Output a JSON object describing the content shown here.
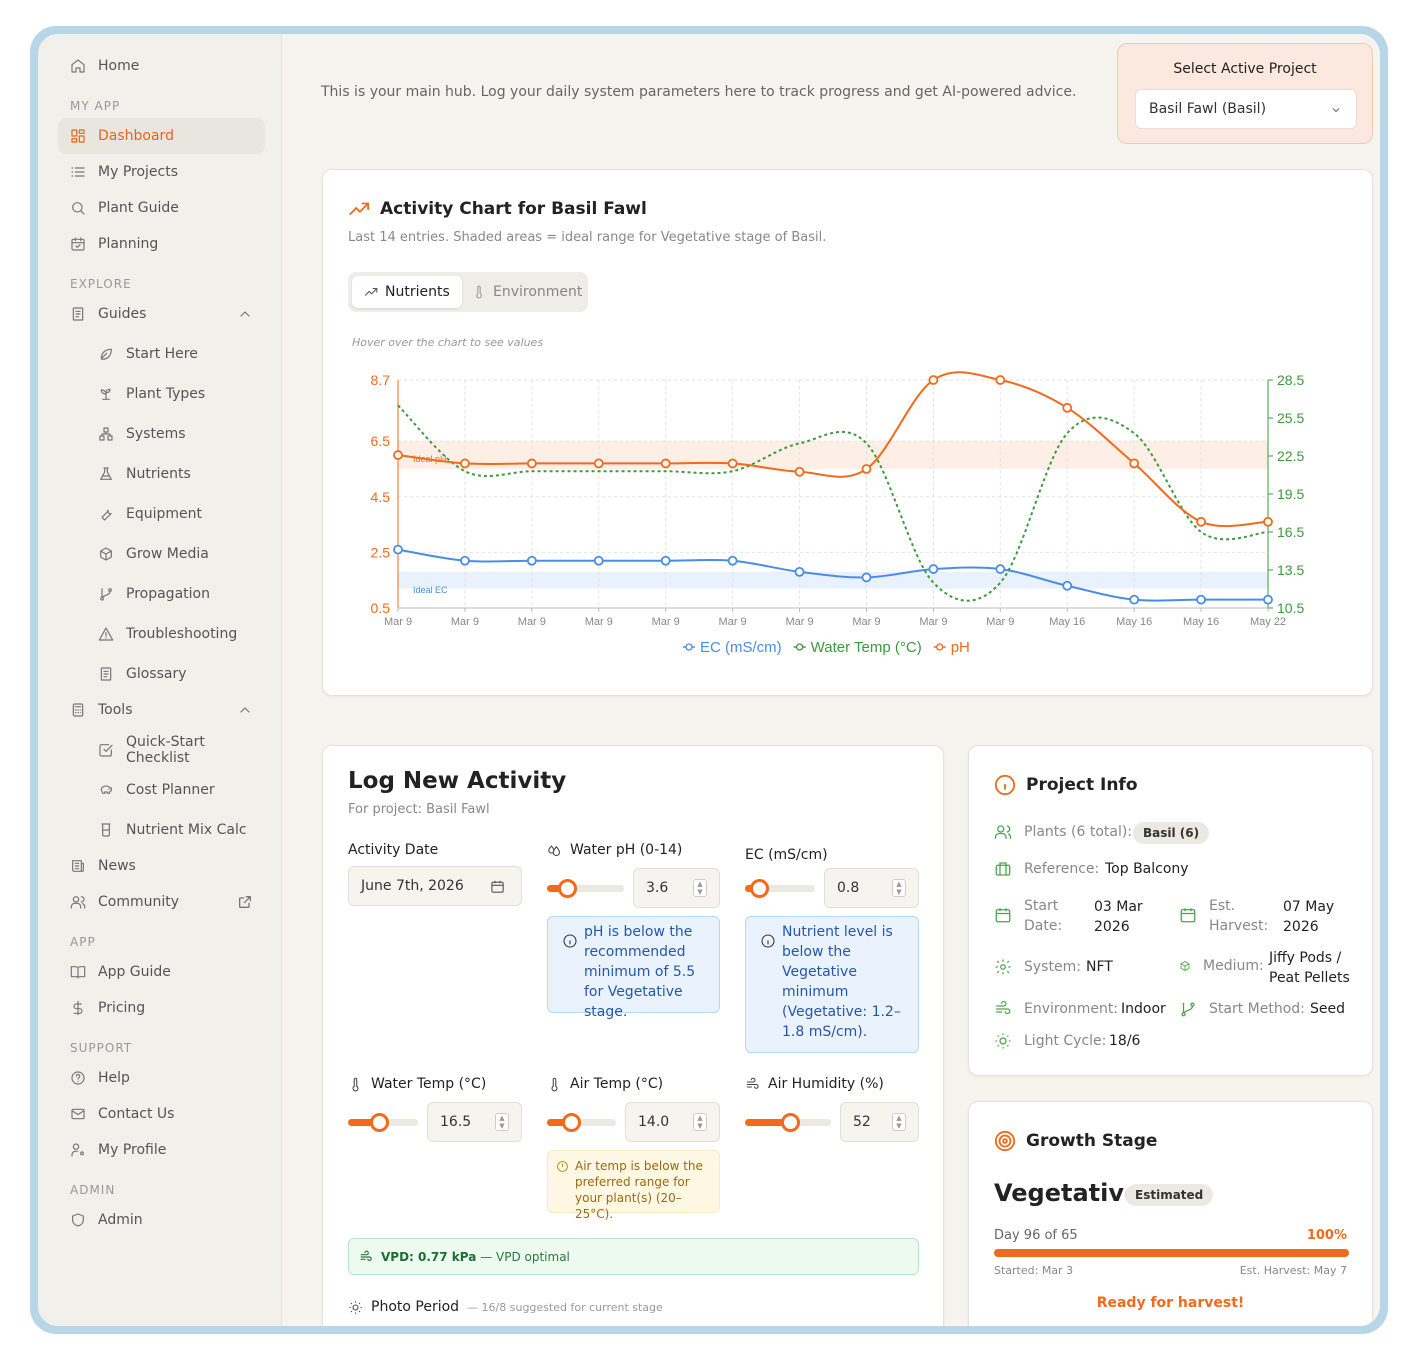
{
  "sidebar": {
    "home": "Home",
    "sections": {
      "my_app": "MY APP",
      "explore": "EXPLORE",
      "app": "APP",
      "support": "SUPPORT",
      "admin": "ADMIN"
    },
    "dashboard": "Dashboard",
    "my_projects": "My Projects",
    "plant_guide": "Plant Guide",
    "planning": "Planning",
    "guides": "Guides",
    "guide_items": [
      "Start Here",
      "Plant Types",
      "Systems",
      "Nutrients",
      "Equipment",
      "Grow Media",
      "Propagation",
      "Troubleshooting",
      "Glossary"
    ],
    "tools": "Tools",
    "tool_items": [
      "Quick-Start Checklist",
      "Cost Planner",
      "Nutrient Mix Calc"
    ],
    "news": "News",
    "community": "Community",
    "app_guide": "App Guide",
    "pricing": "Pricing",
    "help": "Help",
    "contact": "Contact Us",
    "profile": "My Profile",
    "admin": "Admin"
  },
  "intro": "This is your main hub. Log your daily system parameters here to track progress and get AI-powered advice.",
  "project_select": {
    "title": "Select Active Project",
    "value": "Basil Fawl (Basil)"
  },
  "chart_card": {
    "title": "Activity Chart for Basil Fawl",
    "subtitle": "Last 14 entries. Shaded areas = ideal range for Vegetative stage of Basil.",
    "tab_nutrients": "Nutrients",
    "tab_environment": "Environment",
    "hint": "Hover over the chart to see values"
  },
  "chart_data": {
    "type": "line",
    "x": [
      "Mar 9",
      "Mar 9",
      "Mar 9",
      "Mar 9",
      "Mar 9",
      "Mar 9",
      "Mar 9",
      "Mar 9",
      "Mar 9",
      "Mar 9",
      "May 16",
      "May 16",
      "May 16",
      "May 22"
    ],
    "left_axis": {
      "ticks": [
        "0.5",
        "2.5",
        "4.5",
        "6.5",
        "8.7"
      ],
      "range": [
        0.5,
        8.7
      ],
      "color": "#f26a1b"
    },
    "right_axis": {
      "ticks": [
        "10.5",
        "13.5",
        "16.5",
        "19.5",
        "22.5",
        "25.5",
        "28.5"
      ],
      "range": [
        10.5,
        28.5
      ],
      "color": "#3b9a3b"
    },
    "series": [
      {
        "name": "EC (mS/cm)",
        "axis": "left",
        "color": "#4a8de8",
        "values": [
          2.6,
          2.2,
          2.2,
          2.2,
          2.2,
          2.2,
          1.8,
          1.6,
          1.9,
          1.9,
          1.3,
          0.8,
          0.8,
          0.8
        ]
      },
      {
        "name": "Water Temp (°C)",
        "axis": "right",
        "color": "#3b9a3b",
        "dashed": true,
        "values": [
          26.5,
          21.3,
          21.3,
          21.3,
          21.3,
          21.3,
          23.5,
          23.5,
          12.5,
          12.5,
          24.3,
          24.3,
          16.5,
          16.5
        ]
      },
      {
        "name": "pH",
        "axis": "left",
        "color": "#f26a1b",
        "values": [
          6.0,
          5.7,
          5.7,
          5.7,
          5.7,
          5.7,
          5.4,
          5.5,
          8.7,
          8.7,
          7.7,
          5.7,
          3.6,
          3.6
        ]
      }
    ],
    "bands": [
      {
        "label": "Ideal pH",
        "axis": "left",
        "range": [
          5.5,
          6.5
        ],
        "color": "#fdeee6"
      },
      {
        "label": "Ideal EC",
        "axis": "left",
        "range": [
          1.2,
          1.8
        ],
        "color": "#e9f1fc"
      }
    ],
    "grid": true,
    "legend": "bottom"
  },
  "log": {
    "title": "Log New Activity",
    "subtitle": "For project: Basil Fawl",
    "date_label": "Activity Date",
    "date_value": "June 7th, 2026",
    "ph_label": "Water pH (0-14)",
    "ph_value": "3.6",
    "ph_level": 0.26,
    "ph_alert": "pH is below the recommended minimum of 5.5 for Vegetative stage.",
    "ec_label": "EC (mS/cm)",
    "ec_value": "0.8",
    "ec_level": 0.2,
    "ec_alert": "Nutrient level is below the Vegetative minimum (Vegetative: 1.2–1.8 mS/cm).",
    "water_temp_label": "Water Temp (°C)",
    "water_temp_value": "16.5",
    "water_temp_level": 0.44,
    "air_temp_label": "Air Temp (°C)",
    "air_temp_value": "14.0",
    "air_temp_level": 0.35,
    "air_temp_warn": "Air temp is below the preferred range for your plant(s) (20–25°C).",
    "humidity_label": "Air Humidity (%)",
    "humidity_value": "52",
    "humidity_level": 0.52,
    "vpd_value": "VPD: 0.77 kPa",
    "vpd_note": "— VPD optimal",
    "photo_label": "Photo Period",
    "photo_note": "— 16/8 suggested for current stage"
  },
  "project_info": {
    "title": "Project Info",
    "plants_label": "Plants (6 total):",
    "plants_badge": "Basil (6)",
    "reference_label": "Reference:",
    "reference_value": "Top Balcony",
    "start_label": "Start Date:",
    "start_value": "03 Mar 2026",
    "harvest_label": "Est. Harvest:",
    "harvest_value": "07 May 2026",
    "system_label": "System:",
    "system_value": "NFT",
    "medium_label": "Medium:",
    "medium_value": "Jiffy Pods / Peat Pellets",
    "environment_label": "Environment:",
    "environment_value": "Indoor",
    "method_label": "Start Method:",
    "method_value": "Seed",
    "light_label": "Light Cycle:",
    "light_value": "18/6"
  },
  "growth": {
    "title": "Growth Stage",
    "stage": "Vegetative",
    "badge": "Estimated",
    "day_text": "Day 96 of 65",
    "percent": "100%",
    "progress": 1.0,
    "started": "Started: Mar 3",
    "est_harvest": "Est. Harvest: May 7",
    "ready": "Ready for harvest!"
  },
  "colors": {
    "accent": "#f26a1b",
    "green": "#3b9a3b",
    "blue": "#4a8de8"
  }
}
